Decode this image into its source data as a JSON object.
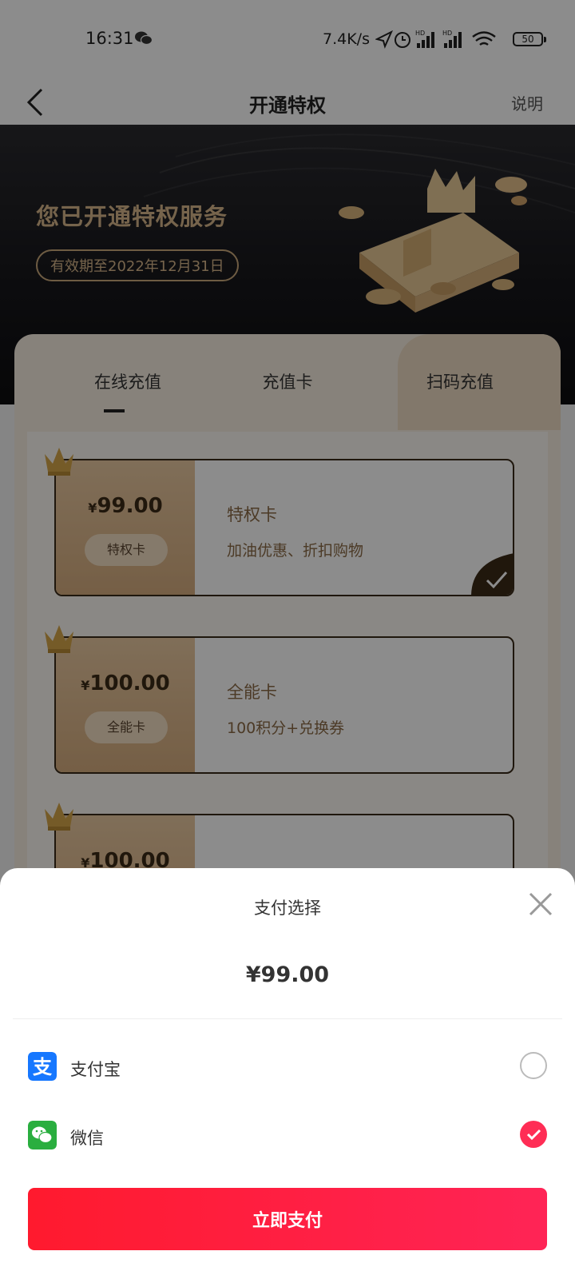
{
  "status_bar": {
    "time": "16:31",
    "speed": "7.4K/s",
    "battery": "50"
  },
  "nav": {
    "title": "开通特权",
    "help": "说明"
  },
  "banner": {
    "headline": "您已开通特权服务",
    "validity": "有效期至2022年12月31日"
  },
  "tabs": [
    {
      "label": "在线充值",
      "active": true
    },
    {
      "label": "充值卡"
    },
    {
      "label": "扫码充值"
    }
  ],
  "products": [
    {
      "price": "99.00",
      "currency": "¥",
      "pill": "特权卡",
      "name": "特权卡",
      "desc": "加油优惠、折扣购物",
      "selected": true
    },
    {
      "price": "100.00",
      "currency": "¥",
      "pill": "全能卡",
      "name": "全能卡",
      "desc": "100积分+兑换券",
      "selected": false
    },
    {
      "price": "100.00",
      "currency": "¥",
      "pill": "",
      "name": "",
      "desc": "",
      "selected": false
    }
  ],
  "payment_sheet": {
    "title": "支付选择",
    "amount": "¥99.00",
    "methods": [
      {
        "label": "支付宝",
        "icon": "alipay-icon",
        "color": "#1677ff",
        "selected": false
      },
      {
        "label": "微信",
        "icon": "wechat-icon",
        "color": "#2aae3f",
        "selected": true
      }
    ],
    "pay_button": "立即支付",
    "accent": "#ff2d55"
  },
  "colors": {
    "gold": "#d8b78a",
    "brown": "#3b2a17",
    "pay_red": "#ff1a2e"
  }
}
